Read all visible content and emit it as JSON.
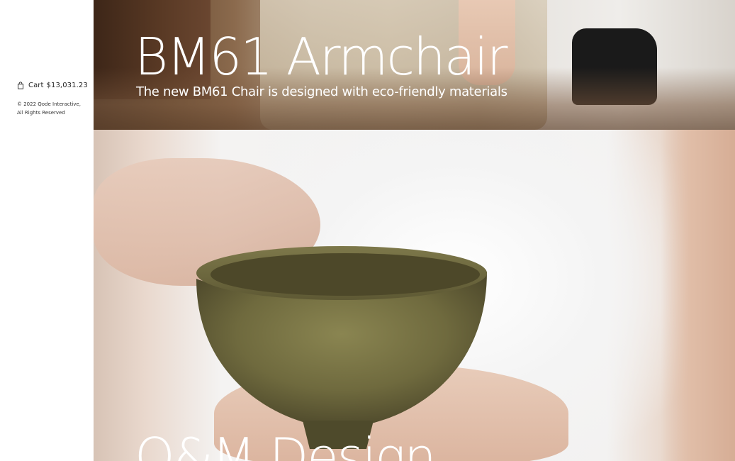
{
  "sidebar": {
    "cart_label": "Cart",
    "cart_total": "$13,031.23",
    "cart_icon": "shopping-bag-icon",
    "copyright_line1": "© 2022 Qode Interactive,",
    "copyright_line2": "All Rights Reserved"
  },
  "heroes": [
    {
      "title": "BM61 Armchair",
      "subtitle": "The new BM61 Chair is designed with eco-friendly materials"
    },
    {
      "title": "Q&M Design"
    }
  ],
  "colors": {
    "background": "#ffffff",
    "hero_text": "#ffffff",
    "sidebar_text": "#222222"
  }
}
